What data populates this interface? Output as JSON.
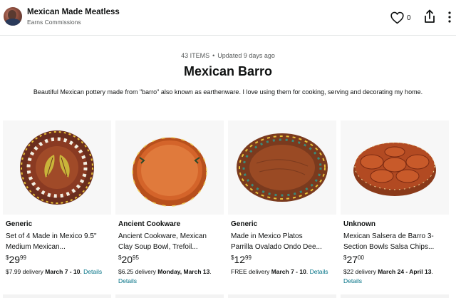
{
  "header": {
    "store_name": "Mexican Made Meatless",
    "subtitle": "Earns Commissions",
    "like_count": "0",
    "icons": [
      "avatar",
      "heart-icon",
      "share-icon",
      "more-vertical-icon"
    ]
  },
  "list": {
    "item_count": "43 ITEMS",
    "updated": "Updated 9 days ago",
    "title": "Mexican Barro",
    "description": "Beautiful Mexican pottery made from \"barro\" also known as earthenware. I love using them for cooking, serving and decorating my home."
  },
  "products": [
    {
      "brand": "Generic",
      "name_line1": "Set of 4 Made in Mexico 9.5\"",
      "name_line2": "Medium Mexican...",
      "price_symbol": "$",
      "price_whole": "29",
      "price_fraction": "99",
      "delivery_prefix": "$7.99 delivery ",
      "delivery_dates": "March 7 - 10",
      "delivery_sep": ". ",
      "details_link": "Details"
    },
    {
      "brand": "Ancient Cookware",
      "name_line1": "Ancient Cookware, Mexican",
      "name_line2": "Clay Soup Bowl, Trefoil...",
      "price_symbol": "$",
      "price_whole": "20",
      "price_fraction": "95",
      "delivery_prefix": "$6.25 delivery ",
      "delivery_dates": "Monday, March 13",
      "delivery_sep": ".",
      "details_link": "Details"
    },
    {
      "brand": "Generic",
      "name_line1": "Made in Mexico Platos",
      "name_line2": "Parrilla Ovalado Ondo Dee...",
      "price_symbol": "$",
      "price_whole": "12",
      "price_fraction": "99",
      "delivery_prefix": "FREE delivery ",
      "delivery_dates": "March 7 - 10",
      "delivery_sep": ". ",
      "details_link": "Details"
    },
    {
      "brand": "Unknown",
      "name_line1": "Mexican Salsera de Barro 3-",
      "name_line2": "Section Bowls Salsa Chips...",
      "price_symbol": "$",
      "price_whole": "27",
      "price_fraction": "00",
      "delivery_prefix": "$22 delivery ",
      "delivery_dates": "March 24 - April 13",
      "delivery_sep": ".",
      "details_link": "Details"
    }
  ],
  "colors": {
    "link": "#007185",
    "text": "#0f1111",
    "muted": "#565959",
    "image_bg": "#f7f7f7"
  }
}
